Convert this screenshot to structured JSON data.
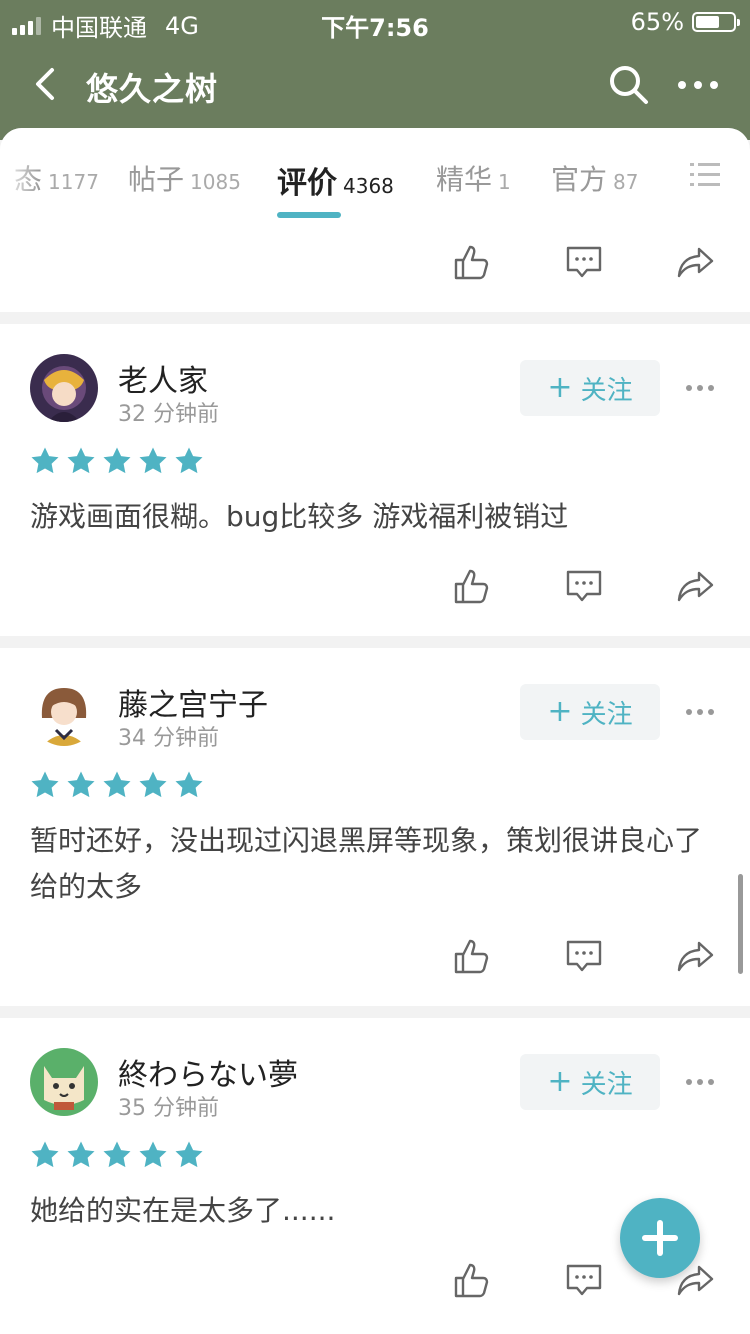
{
  "status_bar": {
    "carrier": "中国联通",
    "network": "4G",
    "time": "下午7:56",
    "battery": "65%",
    "battery_level": 0.65
  },
  "nav": {
    "title": "悠久之树"
  },
  "tabs": [
    {
      "label": "态",
      "count": "1177",
      "active": false
    },
    {
      "label": "帖子",
      "count": "1085",
      "active": false
    },
    {
      "label": "评价",
      "count": "4368",
      "active": true
    },
    {
      "label": "精华",
      "count": "1",
      "active": false
    },
    {
      "label": "官方",
      "count": "87",
      "active": false
    }
  ],
  "follow_label": "关注",
  "follow_plus": "+",
  "reviews": [
    {
      "name": "老人家",
      "time": "32 分钟前",
      "stars": 5,
      "text": "游戏画面很糊。bug比较多 游戏福利被销过"
    },
    {
      "name": "藤之宫宁子",
      "time": "34 分钟前",
      "stars": 5,
      "text": "暂时还好，没出现过闪退黑屏等现象，策划很讲良心了给的太多"
    },
    {
      "name": "終わらない夢",
      "time": "35 分钟前",
      "stars": 5,
      "text": "她给的实在是太多了......"
    }
  ],
  "colors": {
    "header": "#6b7d5e",
    "accent": "#4fb3c3"
  },
  "icons": [
    "back-arrow-icon",
    "search-icon",
    "more-icon",
    "list-icon",
    "like-icon",
    "comment-icon",
    "share-icon",
    "star-icon",
    "plus-icon"
  ]
}
